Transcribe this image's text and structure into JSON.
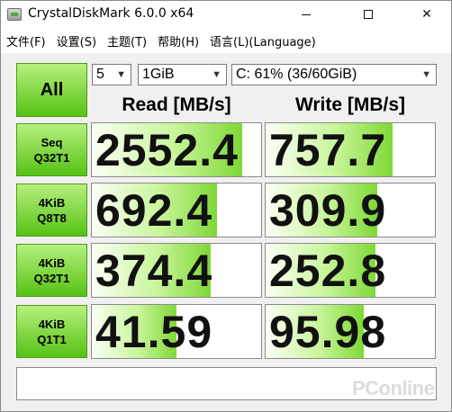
{
  "window": {
    "title": "CrystalDiskMark 6.0.0 x64",
    "minimize_label": "",
    "maximize_label": "",
    "close_label": "✕"
  },
  "menu": [
    {
      "label": "文件(F)"
    },
    {
      "label": "设置(S)"
    },
    {
      "label": "主题(T)"
    },
    {
      "label": "帮助(H)"
    },
    {
      "label": "语言(L)(Language)"
    }
  ],
  "controls": {
    "all_button": "All",
    "test_count": "5",
    "test_size": "1GiB",
    "drive": "C: 61% (36/60GiB)"
  },
  "headers": {
    "read": "Read [MB/s]",
    "write": "Write [MB/s]"
  },
  "rows": [
    {
      "line1": "Seq",
      "line2": "Q32T1",
      "read": "2552.4",
      "write": "757.7",
      "read_fill": 0.89,
      "write_fill": 0.75
    },
    {
      "line1": "4KiB",
      "line2": "Q8T8",
      "read": "692.4",
      "write": "309.9",
      "read_fill": 0.74,
      "write_fill": 0.66
    },
    {
      "line1": "4KiB",
      "line2": "Q32T1",
      "read": "374.4",
      "write": "252.8",
      "read_fill": 0.7,
      "write_fill": 0.65
    },
    {
      "line1": "4KiB",
      "line2": "Q1T1",
      "read": "41.59",
      "write": "95.98",
      "read_fill": 0.5,
      "write_fill": 0.58
    }
  ],
  "comment": "",
  "watermark": "PConline"
}
